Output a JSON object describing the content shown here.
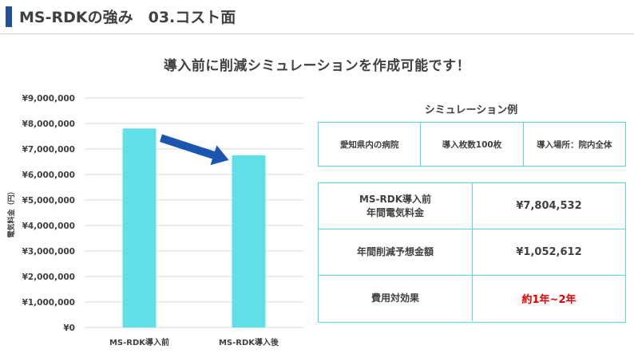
{
  "header": {
    "title": "MS-RDKの強み　03.コスト面",
    "accent_color": "#1f4e9c"
  },
  "subtitle": "導入前に削減シミュレーションを作成可能です！",
  "chart_data": {
    "type": "bar",
    "categories": [
      "MS-RDK導入前",
      "MS-RDK導入後"
    ],
    "values": [
      7804532,
      6751920
    ],
    "ylabel": "電気料金（円）",
    "ylim": [
      0,
      9000000
    ],
    "yticks": [
      0,
      1000000,
      2000000,
      3000000,
      4000000,
      5000000,
      6000000,
      7000000,
      8000000,
      9000000
    ],
    "ytick_labels": [
      "¥0",
      "¥1,000,000",
      "¥2,000,000",
      "¥3,000,000",
      "¥4,000,000",
      "¥5,000,000",
      "¥6,000,000",
      "¥7,000,000",
      "¥8,000,000",
      "¥9,000,000"
    ],
    "grid": true,
    "bar_color": "#5fe0e6",
    "arrow_color": "#1a56b0"
  },
  "simulation": {
    "title": "シミュレーション例",
    "info": [
      "愛知県内の病院",
      "導入枚数100枚",
      "導入場所：院内全体"
    ],
    "rows": [
      {
        "label_lines": [
          "MS-RDK導入前",
          "年間電気料金"
        ],
        "value": "¥7,804,532",
        "highlight": false
      },
      {
        "label_lines": [
          "年間削減予想金額"
        ],
        "value": "¥1,052,612",
        "highlight": false
      },
      {
        "label_lines": [
          "費用対効果"
        ],
        "value": "約1年~2年",
        "highlight": true
      }
    ],
    "border_color": "#57d9e0",
    "highlight_color": "#e00000"
  }
}
